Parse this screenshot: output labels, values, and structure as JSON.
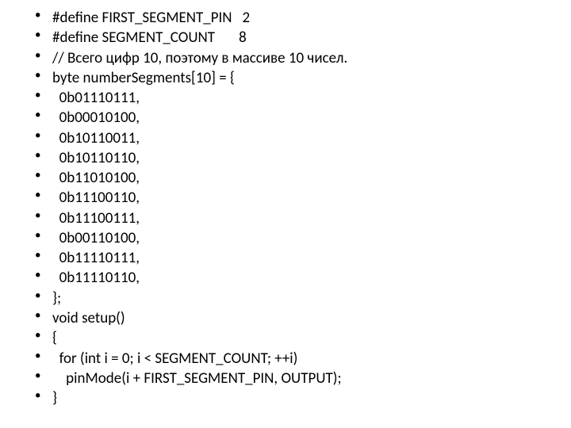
{
  "lines": [
    "#define FIRST_SEGMENT_PIN   2",
    "#define SEGMENT_COUNT       8",
    "// Всего цифр 10, поэтому в массиве 10 чисел.",
    "byte numberSegments[10] = {",
    "  0b01110111,",
    "  0b00010100,",
    "  0b10110011,",
    "  0b10110110,",
    "  0b11010100,",
    "  0b11100110,",
    "  0b11100111,",
    "  0b00110100,",
    "  0b11110111,",
    "  0b11110110,",
    "};",
    "void setup()",
    "{",
    "  for (int i = 0; i < SEGMENT_COUNT; ++i)",
    "    pinMode(i + FIRST_SEGMENT_PIN, OUTPUT);",
    "}"
  ]
}
